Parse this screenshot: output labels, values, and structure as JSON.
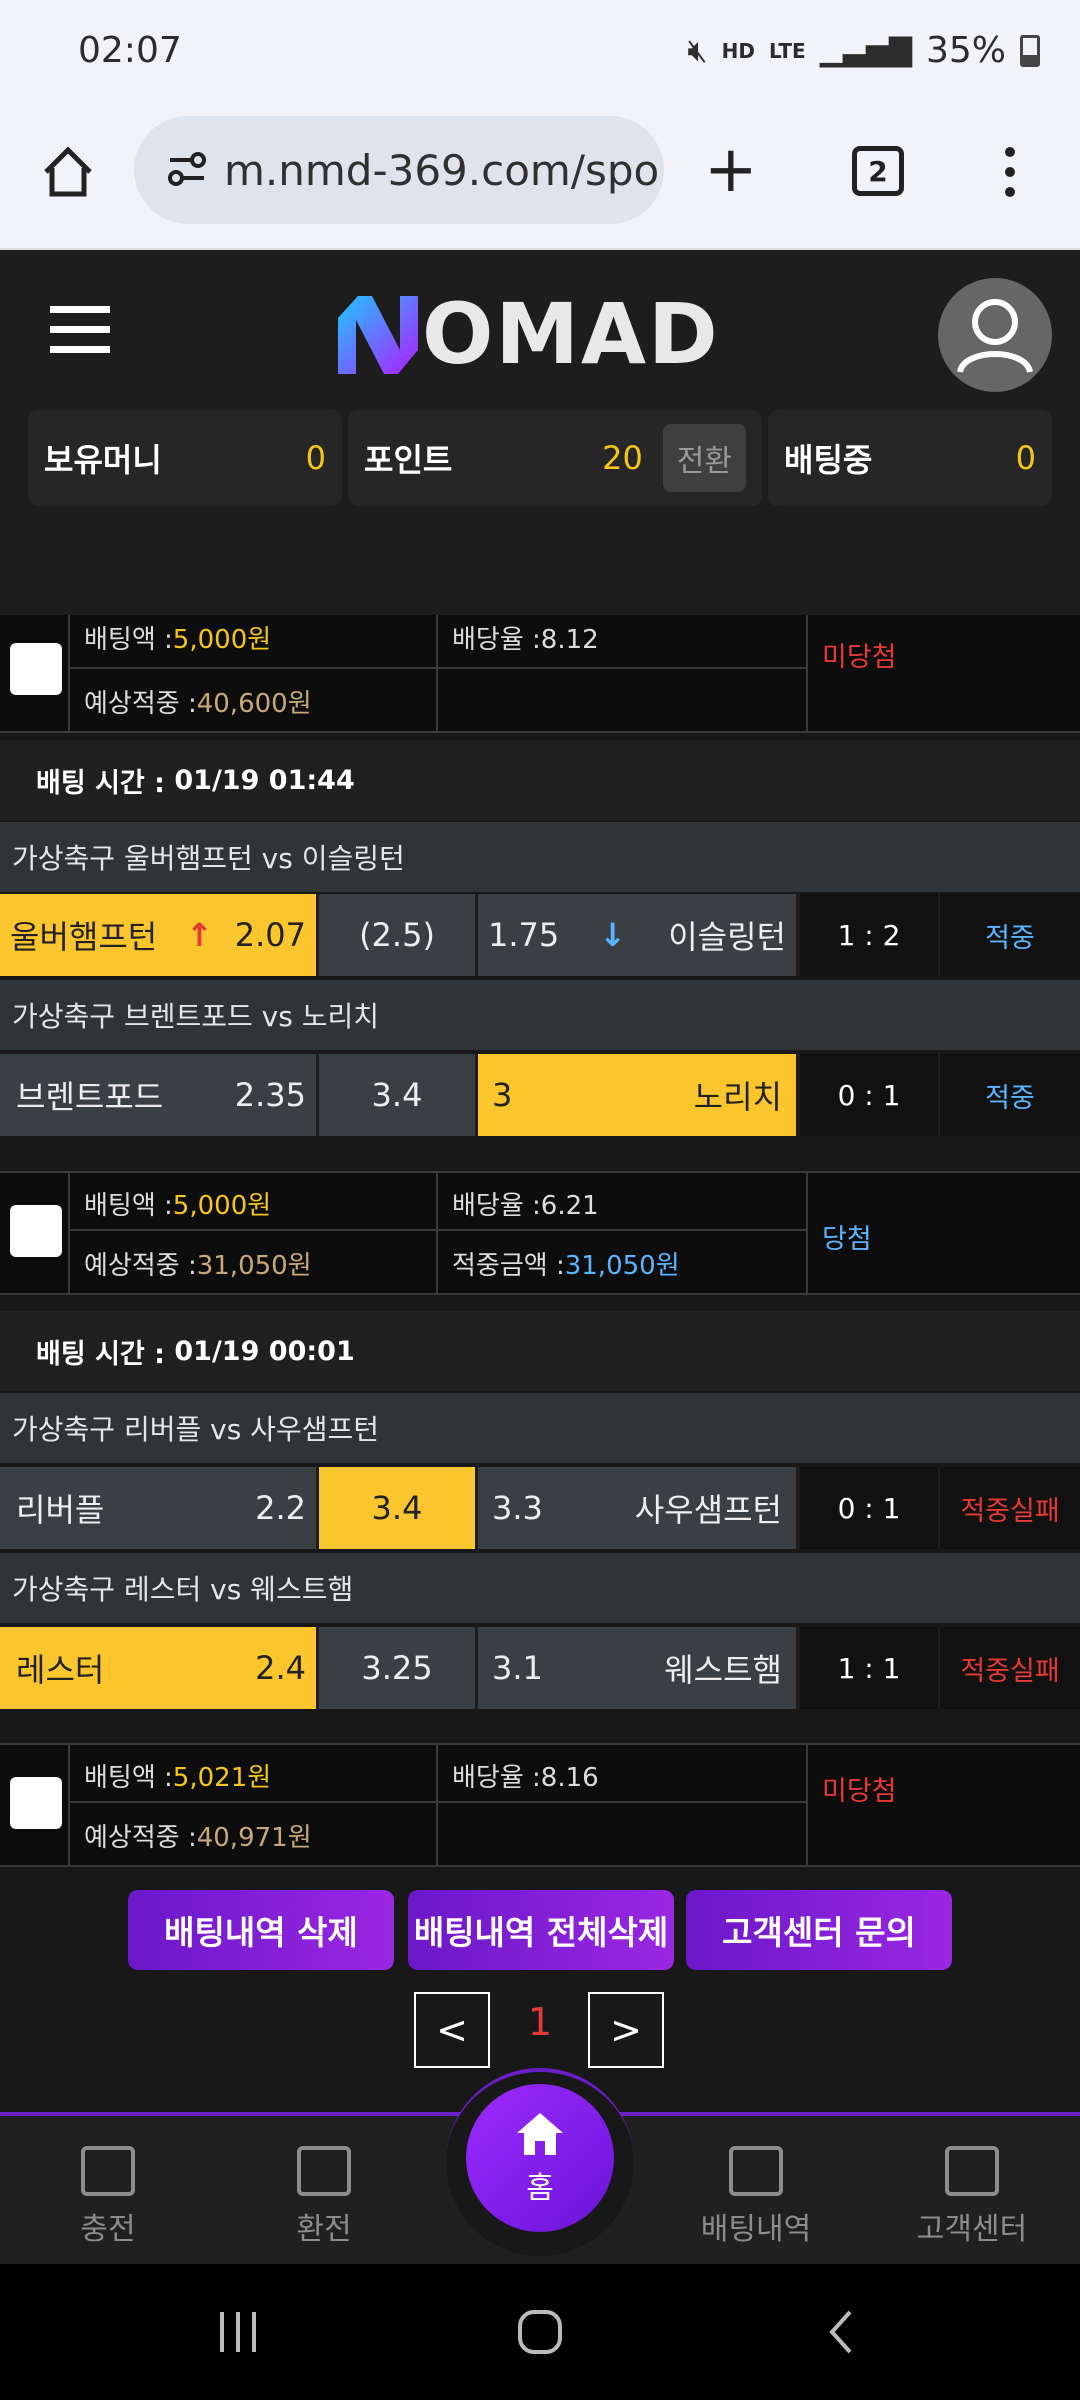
{
  "status": {
    "time": "02:07",
    "battery": "35%",
    "net": "LTE",
    "hd": "HD"
  },
  "browser": {
    "url": "m.nmd-369.com/spo",
    "tabs": "2"
  },
  "header": {
    "logo": "NOMAD"
  },
  "wallet": {
    "money_label": "보유머니",
    "money": "0",
    "point_label": "포인트",
    "point": "20",
    "convert": "전환",
    "betting_label": "배팅중",
    "betting": "0"
  },
  "bets": [
    {
      "amount_label": "배팅액 :",
      "amount": "5,000원",
      "rate_label": "배당율 :",
      "rate": "8.12",
      "expected_label": "예상적중 :",
      "expected": "40,600원",
      "result": "미당첨"
    },
    {
      "time_label": "배팅 시간 :",
      "time": "01/19 01:44",
      "games": [
        {
          "title": "가상축구 울버햄프턴  vs  이슬링턴",
          "home": "울버햄프턴",
          "home_odds": "2.07",
          "draw": "(2.5)",
          "away_odds": "1.75",
          "away": "이슬링턴",
          "score": "1 : 2",
          "result": "적중"
        },
        {
          "title": "가상축구 브렌트포드  vs  노리치",
          "home": "브렌트포드",
          "home_odds": "2.35",
          "draw": "3.4",
          "away_odds": "3",
          "away": "노리치",
          "score": "0 : 1",
          "result": "적중"
        }
      ],
      "amount_label": "배팅액 :",
      "amount": "5,000원",
      "rate_label": "배당율 :",
      "rate": "6.21",
      "expected_label": "예상적중 :",
      "expected": "31,050원",
      "win_label": "적중금액 :",
      "win": "31,050원",
      "result": "당첨"
    },
    {
      "time_label": "배팅 시간 :",
      "time": "01/19 00:01",
      "games": [
        {
          "title": "가상축구 리버플  vs  사우샘프턴",
          "home": "리버플",
          "home_odds": "2.2",
          "draw": "3.4",
          "away_odds": "3.3",
          "away": "사우샘프턴",
          "score": "0 : 1",
          "result": "적중실패"
        },
        {
          "title": "가상축구 레스터  vs  웨스트햄",
          "home": "레스터",
          "home_odds": "2.4",
          "draw": "3.25",
          "away_odds": "3.1",
          "away": "웨스트햄",
          "score": "1 : 1",
          "result": "적중실패"
        }
      ],
      "amount_label": "배팅액 :",
      "amount": "5,021원",
      "rate_label": "배당율 :",
      "rate": "8.16",
      "expected_label": "예상적중 :",
      "expected": "40,971원",
      "result": "미당첨"
    }
  ],
  "buttons": {
    "delete": "배팅내역 삭제",
    "delete_all": "배팅내역 전체삭제",
    "support": "고객센터 문의"
  },
  "pagination": {
    "page": "1",
    "prev": "<",
    "next": ">"
  },
  "nav": {
    "charge": "충전",
    "exchange": "환전",
    "home": "홈",
    "history": "배팅내역",
    "center": "고객센터"
  },
  "colors": {
    "accent": "#f5c518",
    "selected": "#fbc52e",
    "win": "#5ab4ff",
    "lose": "#e53935",
    "purple": "#7b1fd9"
  }
}
